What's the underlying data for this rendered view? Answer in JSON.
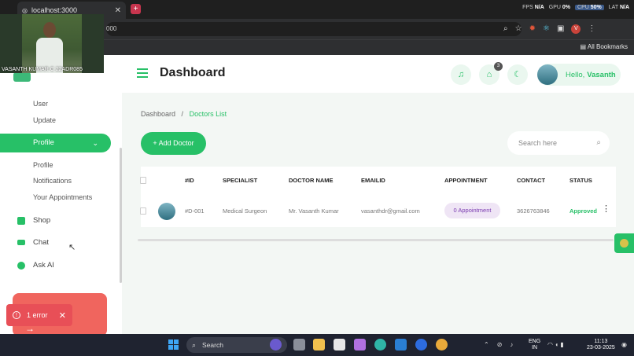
{
  "browser": {
    "tab_title": "localhost:3000",
    "url": "000",
    "bookmarks_label": "All Bookmarks",
    "stats": {
      "fps_label": "FPS",
      "fps": "N/A",
      "gpu_label": "GPU",
      "gpu": "0%",
      "cpu_label": "CPU",
      "cpu": "50%",
      "lat_label": "LAT",
      "lat": "N/A"
    },
    "profile_initial": "V"
  },
  "webcam": {
    "label": "VASANTH KUMAR C 22ADR085"
  },
  "sidebar": {
    "sub_top": [
      {
        "label": "User"
      },
      {
        "label": "Update"
      }
    ],
    "active": {
      "label": "Profile"
    },
    "sub_profile": [
      {
        "label": "Profile"
      },
      {
        "label": "Notifications"
      },
      {
        "label": "Your Appointments"
      }
    ],
    "main_items": [
      {
        "label": "Shop"
      },
      {
        "label": "Chat"
      },
      {
        "label": "Ask AI"
      }
    ]
  },
  "toast": {
    "text": "1 error"
  },
  "header": {
    "title": "Dashboard",
    "gift_badge": "3",
    "greeting": "Hello,",
    "user_name": "Vasanth"
  },
  "breadcrumb": {
    "root": "Dashboard",
    "separator": "/",
    "current": "Doctors List"
  },
  "actions": {
    "add_label": "+ Add Doctor",
    "search_placeholder": "Search here"
  },
  "table": {
    "columns": [
      "#ID",
      "SPECIALIST",
      "DOCTOR NAME",
      "EMAILID",
      "APPOINTMENT",
      "CONTACT",
      "STATUS"
    ],
    "rows": [
      {
        "id": "#D-001",
        "specialist": "Medical Surgeon",
        "name": "Mr. Vasanth Kumar",
        "email": "vasanthdr@gmail.com",
        "appointment": "0 Appointment",
        "contact": "3626763846",
        "status": "Approved"
      }
    ]
  },
  "taskbar": {
    "search_label": "Search",
    "lang_top": "ENG",
    "lang_bottom": "IN",
    "time": "11:13",
    "date": "23-03-2025"
  },
  "colors": {
    "accent": "#27c067",
    "toast": "#e84f57",
    "appointment_pill": "#efe5f5"
  }
}
